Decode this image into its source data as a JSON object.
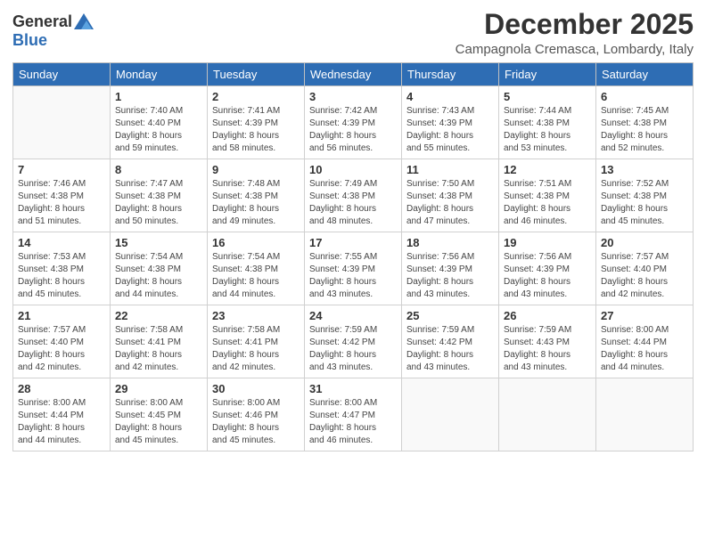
{
  "logo": {
    "general": "General",
    "blue": "Blue"
  },
  "title": "December 2025",
  "location": "Campagnola Cremasca, Lombardy, Italy",
  "weekdays": [
    "Sunday",
    "Monday",
    "Tuesday",
    "Wednesday",
    "Thursday",
    "Friday",
    "Saturday"
  ],
  "weeks": [
    [
      {
        "day": "",
        "info": ""
      },
      {
        "day": "1",
        "info": "Sunrise: 7:40 AM\nSunset: 4:40 PM\nDaylight: 8 hours\nand 59 minutes."
      },
      {
        "day": "2",
        "info": "Sunrise: 7:41 AM\nSunset: 4:39 PM\nDaylight: 8 hours\nand 58 minutes."
      },
      {
        "day": "3",
        "info": "Sunrise: 7:42 AM\nSunset: 4:39 PM\nDaylight: 8 hours\nand 56 minutes."
      },
      {
        "day": "4",
        "info": "Sunrise: 7:43 AM\nSunset: 4:39 PM\nDaylight: 8 hours\nand 55 minutes."
      },
      {
        "day": "5",
        "info": "Sunrise: 7:44 AM\nSunset: 4:38 PM\nDaylight: 8 hours\nand 53 minutes."
      },
      {
        "day": "6",
        "info": "Sunrise: 7:45 AM\nSunset: 4:38 PM\nDaylight: 8 hours\nand 52 minutes."
      }
    ],
    [
      {
        "day": "7",
        "info": "Sunrise: 7:46 AM\nSunset: 4:38 PM\nDaylight: 8 hours\nand 51 minutes."
      },
      {
        "day": "8",
        "info": "Sunrise: 7:47 AM\nSunset: 4:38 PM\nDaylight: 8 hours\nand 50 minutes."
      },
      {
        "day": "9",
        "info": "Sunrise: 7:48 AM\nSunset: 4:38 PM\nDaylight: 8 hours\nand 49 minutes."
      },
      {
        "day": "10",
        "info": "Sunrise: 7:49 AM\nSunset: 4:38 PM\nDaylight: 8 hours\nand 48 minutes."
      },
      {
        "day": "11",
        "info": "Sunrise: 7:50 AM\nSunset: 4:38 PM\nDaylight: 8 hours\nand 47 minutes."
      },
      {
        "day": "12",
        "info": "Sunrise: 7:51 AM\nSunset: 4:38 PM\nDaylight: 8 hours\nand 46 minutes."
      },
      {
        "day": "13",
        "info": "Sunrise: 7:52 AM\nSunset: 4:38 PM\nDaylight: 8 hours\nand 45 minutes."
      }
    ],
    [
      {
        "day": "14",
        "info": "Sunrise: 7:53 AM\nSunset: 4:38 PM\nDaylight: 8 hours\nand 45 minutes."
      },
      {
        "day": "15",
        "info": "Sunrise: 7:54 AM\nSunset: 4:38 PM\nDaylight: 8 hours\nand 44 minutes."
      },
      {
        "day": "16",
        "info": "Sunrise: 7:54 AM\nSunset: 4:38 PM\nDaylight: 8 hours\nand 44 minutes."
      },
      {
        "day": "17",
        "info": "Sunrise: 7:55 AM\nSunset: 4:39 PM\nDaylight: 8 hours\nand 43 minutes."
      },
      {
        "day": "18",
        "info": "Sunrise: 7:56 AM\nSunset: 4:39 PM\nDaylight: 8 hours\nand 43 minutes."
      },
      {
        "day": "19",
        "info": "Sunrise: 7:56 AM\nSunset: 4:39 PM\nDaylight: 8 hours\nand 43 minutes."
      },
      {
        "day": "20",
        "info": "Sunrise: 7:57 AM\nSunset: 4:40 PM\nDaylight: 8 hours\nand 42 minutes."
      }
    ],
    [
      {
        "day": "21",
        "info": "Sunrise: 7:57 AM\nSunset: 4:40 PM\nDaylight: 8 hours\nand 42 minutes."
      },
      {
        "day": "22",
        "info": "Sunrise: 7:58 AM\nSunset: 4:41 PM\nDaylight: 8 hours\nand 42 minutes."
      },
      {
        "day": "23",
        "info": "Sunrise: 7:58 AM\nSunset: 4:41 PM\nDaylight: 8 hours\nand 42 minutes."
      },
      {
        "day": "24",
        "info": "Sunrise: 7:59 AM\nSunset: 4:42 PM\nDaylight: 8 hours\nand 43 minutes."
      },
      {
        "day": "25",
        "info": "Sunrise: 7:59 AM\nSunset: 4:42 PM\nDaylight: 8 hours\nand 43 minutes."
      },
      {
        "day": "26",
        "info": "Sunrise: 7:59 AM\nSunset: 4:43 PM\nDaylight: 8 hours\nand 43 minutes."
      },
      {
        "day": "27",
        "info": "Sunrise: 8:00 AM\nSunset: 4:44 PM\nDaylight: 8 hours\nand 44 minutes."
      }
    ],
    [
      {
        "day": "28",
        "info": "Sunrise: 8:00 AM\nSunset: 4:44 PM\nDaylight: 8 hours\nand 44 minutes."
      },
      {
        "day": "29",
        "info": "Sunrise: 8:00 AM\nSunset: 4:45 PM\nDaylight: 8 hours\nand 45 minutes."
      },
      {
        "day": "30",
        "info": "Sunrise: 8:00 AM\nSunset: 4:46 PM\nDaylight: 8 hours\nand 45 minutes."
      },
      {
        "day": "31",
        "info": "Sunrise: 8:00 AM\nSunset: 4:47 PM\nDaylight: 8 hours\nand 46 minutes."
      },
      {
        "day": "",
        "info": ""
      },
      {
        "day": "",
        "info": ""
      },
      {
        "day": "",
        "info": ""
      }
    ]
  ]
}
